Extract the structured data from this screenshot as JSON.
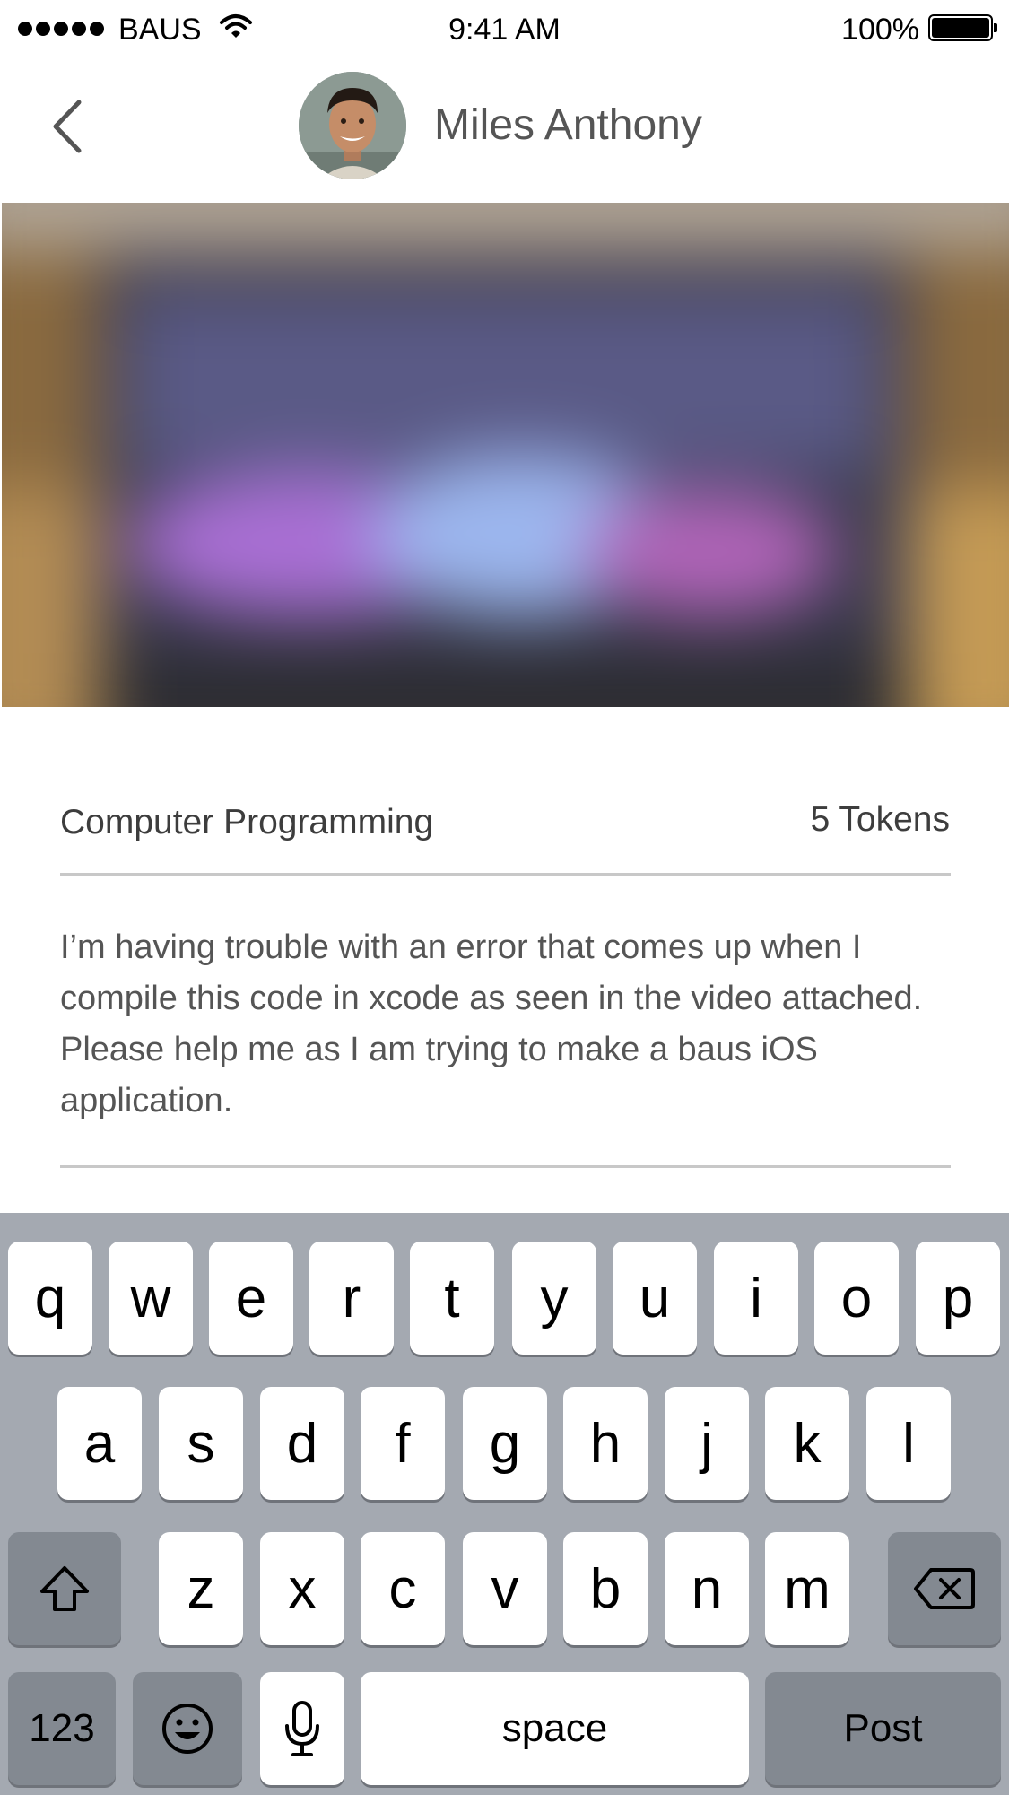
{
  "status_bar": {
    "carrier": "BAUS",
    "time": "9:41 AM",
    "battery": "100%"
  },
  "nav": {
    "user_name": "Miles Anthony",
    "back_icon": "chevron-left-icon"
  },
  "post": {
    "category": "Computer Programming",
    "tokens": "5 Tokens",
    "description": "I’m having trouble with an error that comes up when I compile this code in xcode as seen in the video attached. Please help me as I am trying to make a baus iOS application."
  },
  "keyboard": {
    "row1": [
      "q",
      "w",
      "e",
      "r",
      "t",
      "y",
      "u",
      "i",
      "o",
      "p"
    ],
    "row2": [
      "a",
      "s",
      "d",
      "f",
      "g",
      "h",
      "j",
      "k",
      "l"
    ],
    "row3": [
      "z",
      "x",
      "c",
      "v",
      "b",
      "n",
      "m"
    ],
    "numbers_label": "123",
    "space_label": "space",
    "post_label": "Post",
    "colors": {
      "background": "#a4a9b1",
      "key": "#ffffff",
      "function_key": "#838991"
    }
  }
}
